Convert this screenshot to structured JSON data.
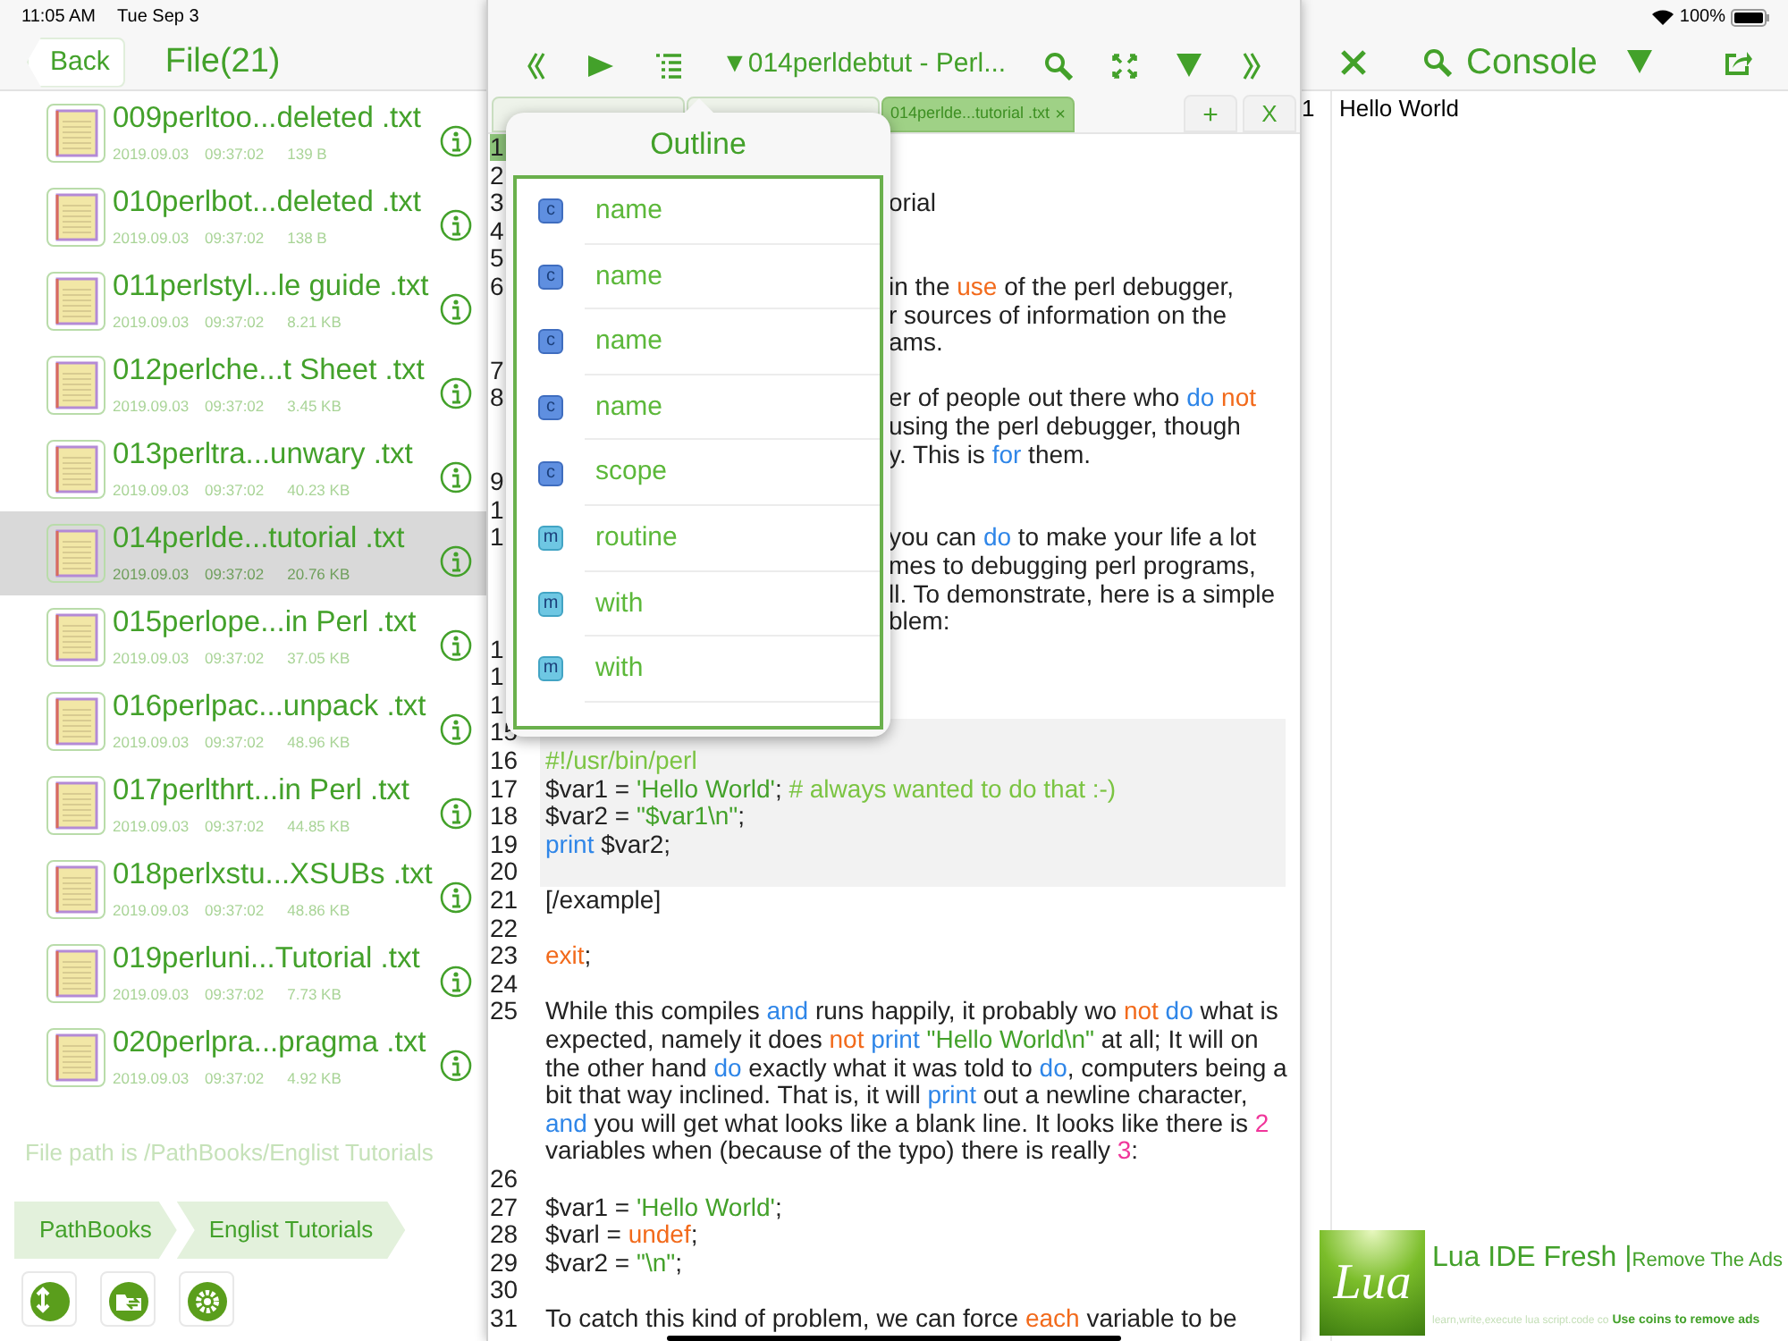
{
  "status_bar": {
    "time": "11:05 AM",
    "date": "Tue Sep 3",
    "battery": "100%"
  },
  "file_panel": {
    "back": "Back",
    "title": "File(21)",
    "files": [
      {
        "name": "009perltoo...deleted .txt",
        "date": "2019.09.03",
        "time": "09:37:02",
        "size": "139 B",
        "selected": false
      },
      {
        "name": "010perlbot...deleted .txt",
        "date": "2019.09.03",
        "time": "09:37:02",
        "size": "138 B",
        "selected": false
      },
      {
        "name": "011perlstyl...le guide .txt",
        "date": "2019.09.03",
        "time": "09:37:02",
        "size": "8.21 KB",
        "selected": false
      },
      {
        "name": "012perlche...t Sheet .txt",
        "date": "2019.09.03",
        "time": "09:37:02",
        "size": "3.45 KB",
        "selected": false
      },
      {
        "name": "013perltra...unwary .txt",
        "date": "2019.09.03",
        "time": "09:37:02",
        "size": "40.23 KB",
        "selected": false
      },
      {
        "name": "014perlde...tutorial .txt",
        "date": "2019.09.03",
        "time": "09:37:02",
        "size": "20.76 KB",
        "selected": true
      },
      {
        "name": "015perlope...in Perl .txt",
        "date": "2019.09.03",
        "time": "09:37:02",
        "size": "37.05 KB",
        "selected": false
      },
      {
        "name": "016perlpac...unpack .txt",
        "date": "2019.09.03",
        "time": "09:37:02",
        "size": "48.96 KB",
        "selected": false
      },
      {
        "name": "017perlthrt...in Perl .txt",
        "date": "2019.09.03",
        "time": "09:37:02",
        "size": "44.85 KB",
        "selected": false
      },
      {
        "name": "018perlxstu...XSUBs .txt",
        "date": "2019.09.03",
        "time": "09:37:02",
        "size": "48.86 KB",
        "selected": false
      },
      {
        "name": "019perluni...Tutorial .txt",
        "date": "2019.09.03",
        "time": "09:37:02",
        "size": "7.73 KB",
        "selected": false
      },
      {
        "name": "020perlpra...pragma .txt",
        "date": "2019.09.03",
        "time": "09:37:02",
        "size": "4.92 KB",
        "selected": false
      }
    ],
    "path_note": "File path is /PathBooks/Englist Tutorials",
    "breadcrumbs": [
      "PathBooks",
      "Englist Tutorials"
    ]
  },
  "editor": {
    "title": "▼014perldebtut - Perl...",
    "tabs": [
      {
        "selected": false
      },
      {
        "selected": false
      },
      {
        "label": "014perlde...tutorial .txt",
        "close": "×",
        "selected": true
      }
    ],
    "add_tab": "+",
    "close_all": "X",
    "lines": [
      {
        "number": "1",
        "current": true
      },
      {
        "number": "2",
        "current": false
      },
      {
        "number": "3",
        "current": false,
        "rows": [
          {
            "segments": [
              {
                "text": "orial",
                "kind": "plain"
              }
            ]
          }
        ]
      },
      {
        "number": "4",
        "current": false
      },
      {
        "number": "5",
        "current": false
      },
      {
        "number": "6",
        "current": false,
        "rows": [
          {
            "segments": [
              {
                "text": "in the ",
                "kind": "plain"
              },
              {
                "text": "use",
                "kind": "builtin"
              },
              {
                "text": " of the perl debugger,",
                "kind": "plain"
              }
            ]
          },
          {
            "segments": [
              {
                "text": "r sources of information on the",
                "kind": "plain"
              }
            ]
          },
          {
            "segments": [
              {
                "text": "ams.",
                "kind": "plain"
              }
            ]
          }
        ]
      },
      {
        "number": "7",
        "current": false
      },
      {
        "number": "8",
        "current": false,
        "rows": [
          {
            "segments": [
              {
                "text": "er of people out there who ",
                "kind": "plain"
              },
              {
                "text": "do",
                "kind": "keyword"
              },
              {
                "text": " not",
                "kind": "builtin"
              }
            ]
          },
          {
            "segments": [
              {
                "text": "using the perl debugger, though",
                "kind": "plain"
              }
            ]
          },
          {
            "segments": [
              {
                "text": "y. This is ",
                "kind": "plain"
              },
              {
                "text": "for",
                "kind": "keyword"
              },
              {
                "text": " them.",
                "kind": "plain"
              }
            ]
          }
        ]
      },
      {
        "number": "9",
        "current": false
      },
      {
        "number": "1",
        "current": false
      },
      {
        "number": "1",
        "current": false,
        "rows": [
          {
            "segments": [
              {
                "text": "you can ",
                "kind": "plain"
              },
              {
                "text": "do",
                "kind": "keyword"
              },
              {
                "text": " to make your life a lot",
                "kind": "plain"
              }
            ]
          },
          {
            "segments": [
              {
                "text": "mes to debugging perl programs,",
                "kind": "plain"
              }
            ]
          },
          {
            "segments": [
              {
                "text": "ll. To demonstrate, here is a simple",
                "kind": "plain"
              }
            ]
          },
          {
            "segments": [
              {
                "text": "blem:",
                "kind": "plain"
              }
            ]
          }
        ]
      },
      {
        "number": "1",
        "current": false
      },
      {
        "number": "1",
        "current": false
      },
      {
        "number": "1",
        "current": false
      },
      {
        "number": "15",
        "current": false,
        "block": true
      },
      {
        "number": "16",
        "current": false,
        "block": true,
        "rows": [
          {
            "segments": [
              {
                "text": "#!/usr/bin/perl",
                "kind": "comment"
              }
            ]
          }
        ]
      },
      {
        "number": "17",
        "current": false,
        "block": true,
        "rows": [
          {
            "segments": [
              {
                "text": "$var1 = ",
                "kind": "plain"
              },
              {
                "text": "'Hello World'",
                "kind": "string"
              },
              {
                "text": "; ",
                "kind": "plain"
              },
              {
                "text": "# always wanted to do that :-)",
                "kind": "comment"
              }
            ]
          }
        ]
      },
      {
        "number": "18",
        "current": false,
        "block": true,
        "rows": [
          {
            "segments": [
              {
                "text": "$var2 = ",
                "kind": "plain"
              },
              {
                "text": "\"$var1\\n\"",
                "kind": "string"
              },
              {
                "text": ";",
                "kind": "plain"
              }
            ]
          }
        ]
      },
      {
        "number": "19",
        "current": false,
        "block": true,
        "rows": [
          {
            "segments": [
              {
                "text": "print",
                "kind": "keyword"
              },
              {
                "text": " $var2;",
                "kind": "plain"
              }
            ]
          }
        ]
      },
      {
        "number": "20",
        "current": false,
        "block": true
      },
      {
        "number": "21",
        "current": false,
        "rows": [
          {
            "segments": [
              {
                "text": "[/example]",
                "kind": "plain"
              }
            ]
          }
        ]
      },
      {
        "number": "22",
        "current": false
      },
      {
        "number": "23",
        "current": false,
        "rows": [
          {
            "segments": [
              {
                "text": "exit",
                "kind": "builtin"
              },
              {
                "text": ";",
                "kind": "plain"
              }
            ]
          }
        ]
      },
      {
        "number": "24",
        "current": false
      },
      {
        "number": "25",
        "current": false,
        "rows": [
          {
            "segments": [
              {
                "text": "While this compiles ",
                "kind": "plain"
              },
              {
                "text": "and",
                "kind": "keyword"
              },
              {
                "text": " runs happily, it probably wo ",
                "kind": "plain"
              },
              {
                "text": "not",
                "kind": "builtin"
              },
              {
                "text": " do",
                "kind": "keyword"
              },
              {
                "text": " what is",
                "kind": "plain"
              }
            ]
          },
          {
            "segments": [
              {
                "text": "expected, namely it does ",
                "kind": "plain"
              },
              {
                "text": "not",
                "kind": "builtin"
              },
              {
                "text": " print",
                "kind": "keyword"
              },
              {
                "text": " \"Hello World\\n\"",
                "kind": "string"
              },
              {
                "text": " at all; It will on",
                "kind": "plain"
              }
            ]
          },
          {
            "segments": [
              {
                "text": "the other hand ",
                "kind": "plain"
              },
              {
                "text": "do",
                "kind": "keyword"
              },
              {
                "text": " exactly what it was told to ",
                "kind": "plain"
              },
              {
                "text": "do",
                "kind": "keyword"
              },
              {
                "text": ", computers being a",
                "kind": "plain"
              }
            ]
          },
          {
            "segments": [
              {
                "text": "bit that way inclined. That is, it will ",
                "kind": "plain"
              },
              {
                "text": "print",
                "kind": "keyword"
              },
              {
                "text": " out a newline character,",
                "kind": "plain"
              }
            ]
          },
          {
            "segments": [
              {
                "text": "and",
                "kind": "keyword"
              },
              {
                "text": " you will get what looks like a blank line. It looks like there is ",
                "kind": "plain"
              },
              {
                "text": "2",
                "kind": "number"
              }
            ]
          },
          {
            "segments": [
              {
                "text": "variables when (because of the typo) there is really ",
                "kind": "plain"
              },
              {
                "text": "3",
                "kind": "number"
              },
              {
                "text": ":",
                "kind": "plain"
              }
            ]
          }
        ]
      },
      {
        "number": "26",
        "current": false
      },
      {
        "number": "27",
        "current": false,
        "rows": [
          {
            "segments": [
              {
                "text": "$var1 = ",
                "kind": "plain"
              },
              {
                "text": "'Hello World'",
                "kind": "string"
              },
              {
                "text": ";",
                "kind": "plain"
              }
            ]
          }
        ]
      },
      {
        "number": "28",
        "current": false,
        "rows": [
          {
            "segments": [
              {
                "text": "$varl = ",
                "kind": "plain"
              },
              {
                "text": "undef",
                "kind": "builtin"
              },
              {
                "text": ";",
                "kind": "plain"
              }
            ]
          }
        ]
      },
      {
        "number": "29",
        "current": false,
        "rows": [
          {
            "segments": [
              {
                "text": "$var2 = ",
                "kind": "plain"
              },
              {
                "text": "\"\\n\"",
                "kind": "string"
              },
              {
                "text": ";",
                "kind": "plain"
              }
            ]
          }
        ]
      },
      {
        "number": "30",
        "current": false
      },
      {
        "number": "31",
        "current": false,
        "rows": [
          {
            "segments": [
              {
                "text": "To catch this kind of problem, we can force ",
                "kind": "plain"
              },
              {
                "text": "each",
                "kind": "builtin"
              },
              {
                "text": " variable to be",
                "kind": "plain"
              }
            ]
          }
        ]
      }
    ]
  },
  "outline": {
    "title": "Outline",
    "items": [
      {
        "kind": "class",
        "badge": "c",
        "name": "name"
      },
      {
        "kind": "class",
        "badge": "c",
        "name": "name"
      },
      {
        "kind": "class",
        "badge": "c",
        "name": "name"
      },
      {
        "kind": "class",
        "badge": "c",
        "name": "name"
      },
      {
        "kind": "class",
        "badge": "c",
        "name": "scope"
      },
      {
        "kind": "method",
        "badge": "m",
        "name": "routine"
      },
      {
        "kind": "method",
        "badge": "m",
        "name": "with"
      },
      {
        "kind": "method",
        "badge": "m",
        "name": "with"
      }
    ]
  },
  "console": {
    "title": "Console",
    "lines": [
      {
        "number": "1",
        "text": "Hello World"
      }
    ]
  },
  "ad": {
    "logo": "Lua",
    "title": "Lua IDE Fresh |",
    "action": "Remove The Ads",
    "subtitle": "learn,write,execute lua script.code co",
    "note": "Use coins to remove ads"
  }
}
